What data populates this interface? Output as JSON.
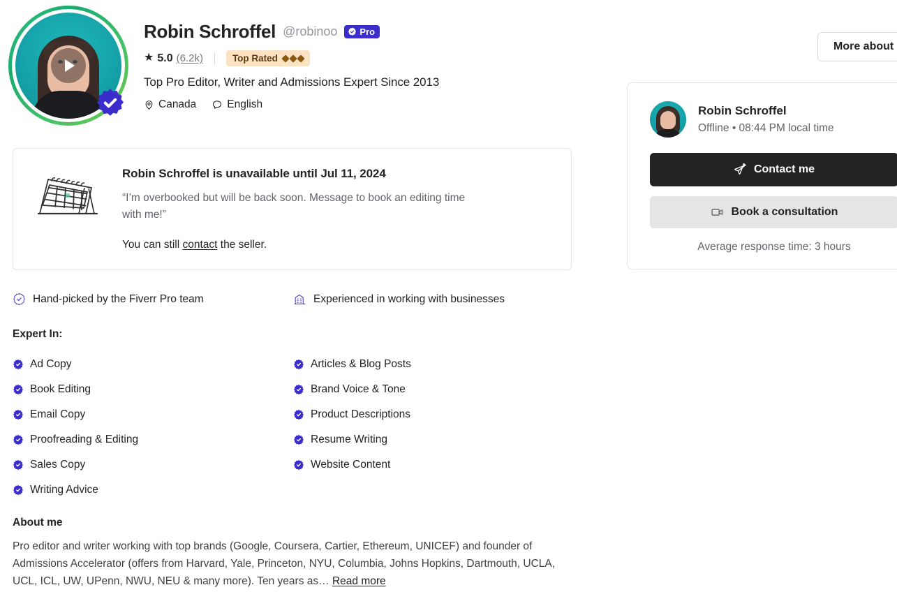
{
  "seller": {
    "name": "Robin Schroffel",
    "handle": "@robinoo",
    "pro_label": "Pro",
    "rating_score": "5.0",
    "rating_count": "(6.2k)",
    "top_rated_label": "Top Rated",
    "tagline": "Top Pro Editor, Writer and Admissions Expert Since 2013",
    "country": "Canada",
    "language": "English",
    "avatar_ring_color": "#2ec27e",
    "verified_badge_color": "#3b2ccc",
    "pro_badge_color": "#3b2ccc",
    "top_rated_bg": "#fae2c3",
    "top_rated_fg": "#5f3d0d"
  },
  "header_actions": {
    "more_about_label": "More about r"
  },
  "notice": {
    "title": "Robin Schroffel is unavailable until Jul 11, 2024",
    "quote": "“I’m overbooked but will be back soon. Message to book an editing time with me!”",
    "contact_prefix": "You can still ",
    "contact_link": "contact",
    "contact_suffix": " the seller.",
    "illustration": "desk-calendar-illustration"
  },
  "highlights": [
    {
      "icon": "rosette-check-outline-icon",
      "label": "Hand-picked by the Fiverr Pro team"
    },
    {
      "icon": "office-building-outline-icon",
      "label": "Experienced in working with businesses"
    }
  ],
  "expert_in": {
    "title": "Expert In:",
    "items": [
      "Ad Copy",
      "Book Editing",
      "Email Copy",
      "Proofreading & Editing",
      "Sales Copy",
      "Writing Advice",
      "Articles & Blog Posts",
      "Brand Voice & Tone",
      "Product Descriptions",
      "Resume Writing",
      "Website Content"
    ]
  },
  "about": {
    "title": "About me",
    "text": "Pro editor and writer working with top brands (Google, Coursera, Cartier, Ethereum, UNICEF) and founder of Admissions Accelerator (offers from Harvard, Yale, Princeton, NYU, Columbia, Johns Hopkins, Dartmouth, UCLA, UCL, ICL, UW, UPenn, NWU, NEU & many more). Ten years as… ",
    "read_more": "Read more"
  },
  "contact_card": {
    "name": "Robin Schroffel",
    "status": "Offline • 08:44 PM local time",
    "contact_label": "Contact me",
    "book_label": "Book a consultation",
    "response_time": "Average response time: 3 hours",
    "contact_bg": "#222325",
    "book_bg": "#e4e5e7"
  }
}
